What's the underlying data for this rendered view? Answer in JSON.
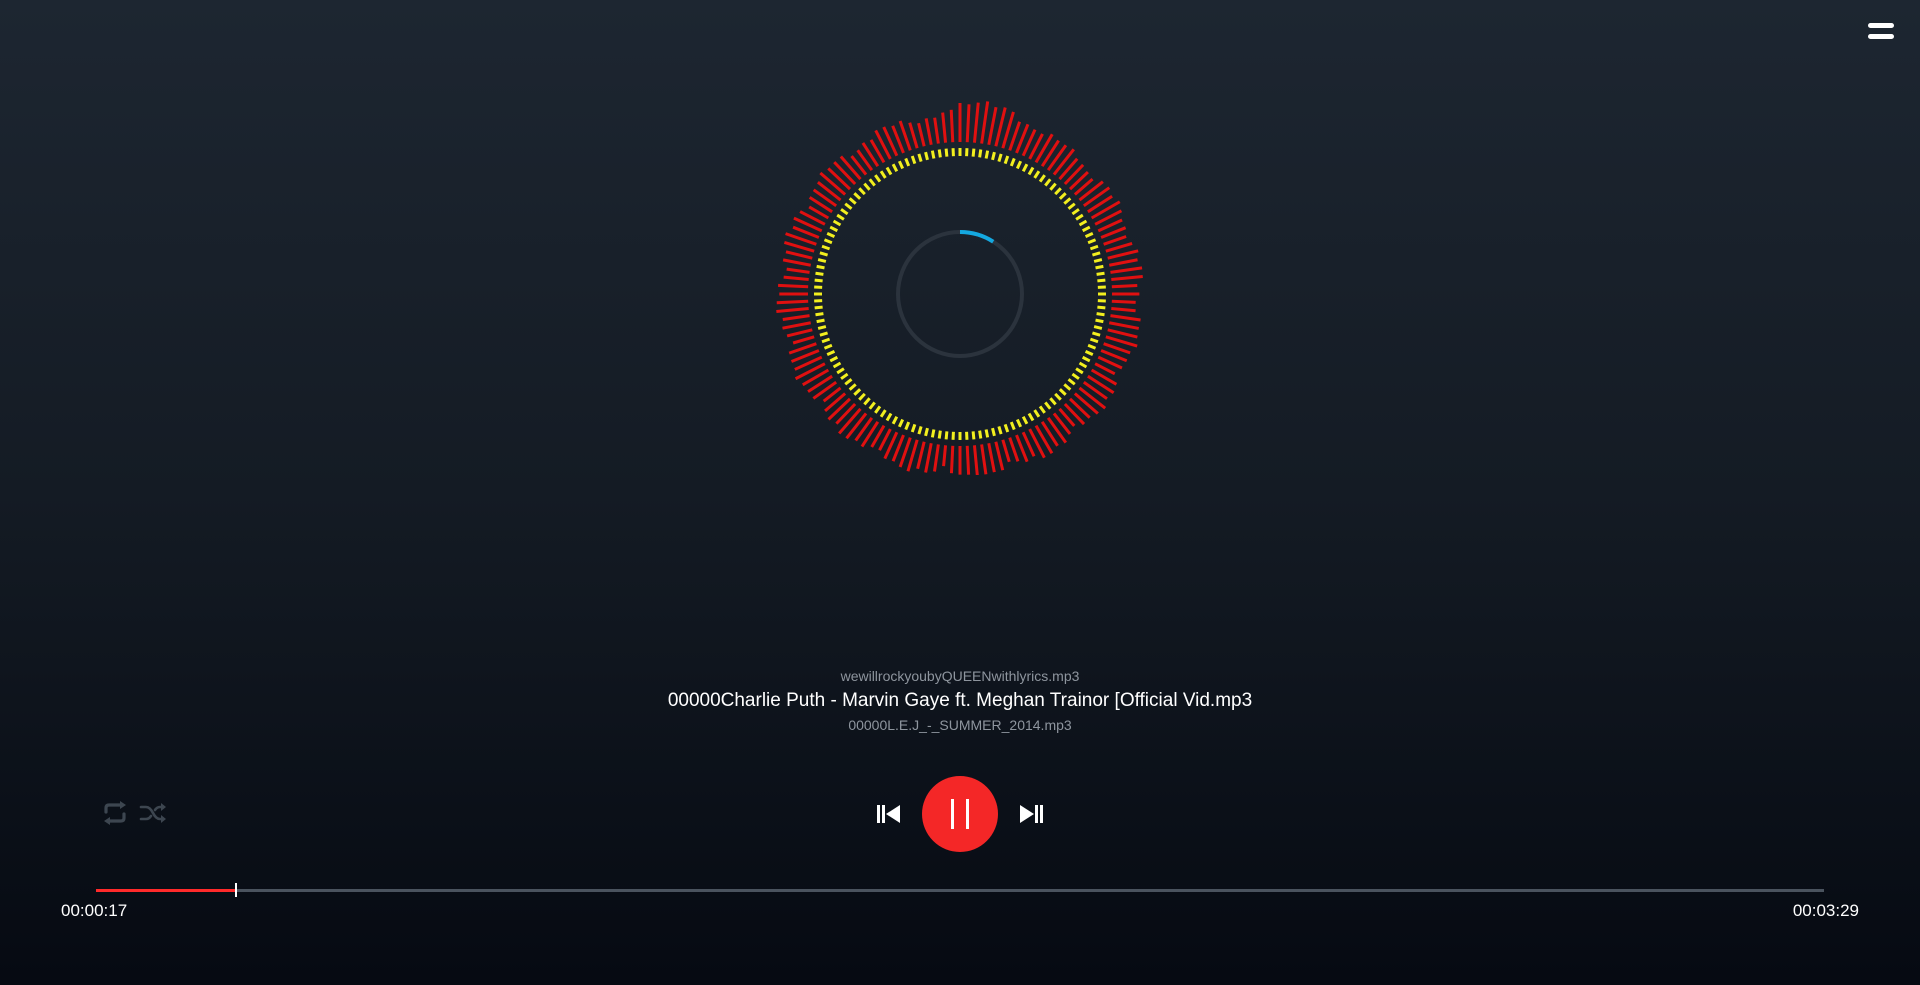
{
  "menu": {
    "icon": "hamburger-menu-icon"
  },
  "visualizer": {
    "loading_progress": 0.09,
    "colors": {
      "outer_bar": "#e01010",
      "inner_dot": "#f2ef1e",
      "ring": "#2b333d",
      "ring_progress": "#14a8e0"
    }
  },
  "playlist": {
    "previous": "wewillrockyoubyQUEENwithlyrics.mp3",
    "current": "00000Charlie Puth - Marvin Gaye ft. Meghan Trainor [Official Vid.mp3",
    "next": "00000L.E.J_-_SUMMER_2014.mp3"
  },
  "controls": {
    "repeat_icon": "repeat-icon",
    "shuffle_icon": "shuffle-icon",
    "previous_icon": "skip-previous-icon",
    "pause_icon": "pause-icon",
    "next_icon": "skip-next-icon",
    "accent_color": "#f42727"
  },
  "progress": {
    "elapsed": "00:00:17",
    "total": "00:03:29",
    "fraction": 0.0813
  }
}
